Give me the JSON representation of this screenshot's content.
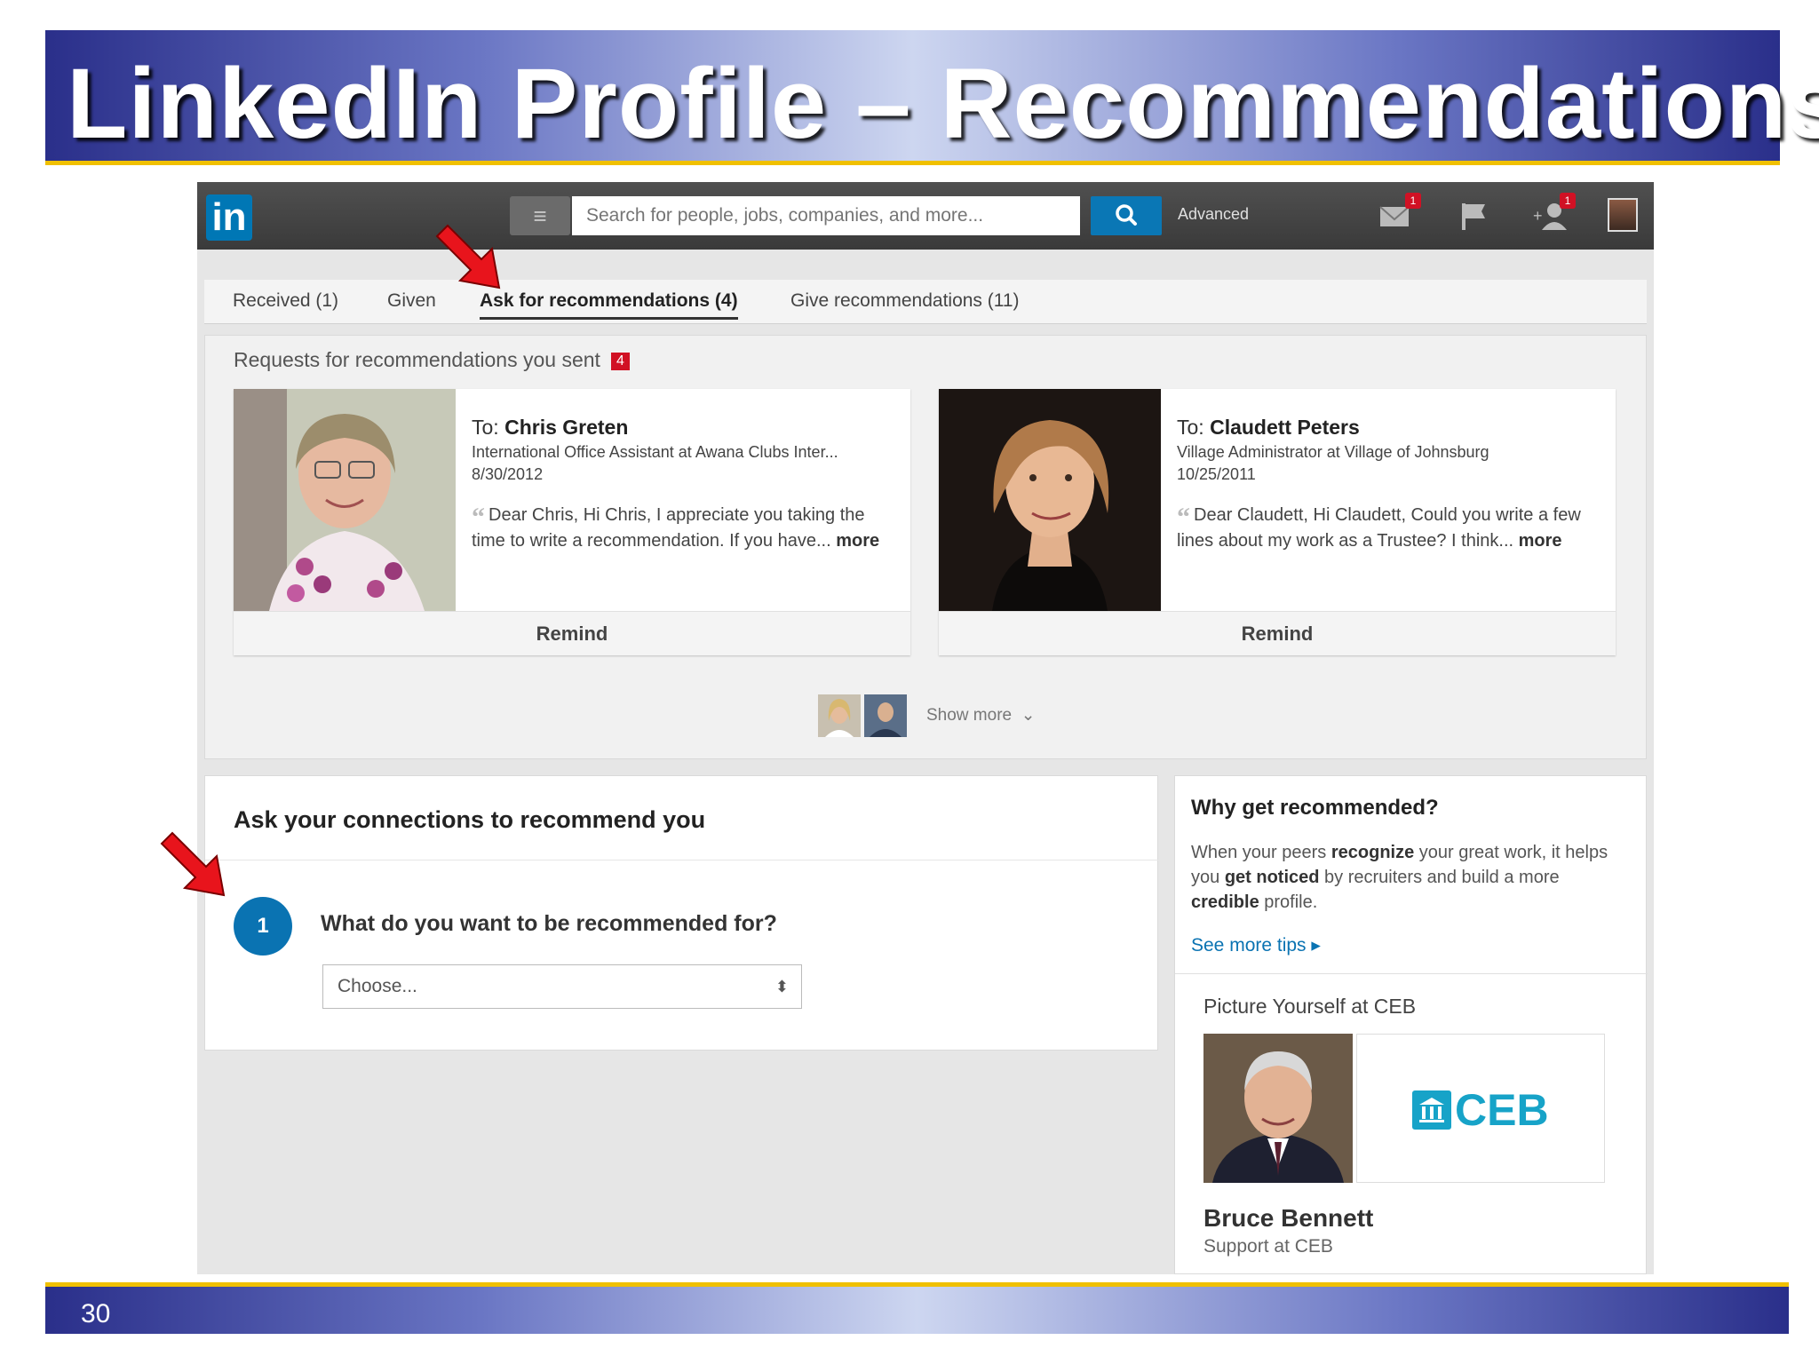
{
  "slide": {
    "title": "LinkedIn Profile – Recommendations",
    "page_number": "30"
  },
  "navbar": {
    "logo": "in",
    "search_placeholder": "Search for people, jobs, companies, and more...",
    "advanced_label": "Advanced",
    "messages_badge": "1",
    "connections_badge": "1"
  },
  "tabs": [
    {
      "label": "Received (1)"
    },
    {
      "label": "Given"
    },
    {
      "label": "Ask for recommendations (4)"
    },
    {
      "label": "Give recommendations (11)"
    }
  ],
  "requests": {
    "title": "Requests for recommendations you sent",
    "count": "4",
    "cards": [
      {
        "to_prefix": "To:",
        "name": "Chris Greten",
        "headline": "International Office Assistant at Awana Clubs Inter...",
        "date": "8/30/2012",
        "message": "Dear Chris, Hi Chris, I appreciate you taking the time to write a recommendation. If you have...",
        "more_label": "more",
        "remind_label": "Remind"
      },
      {
        "to_prefix": "To:",
        "name": "Claudett Peters",
        "headline": "Village Administrator at Village of Johnsburg",
        "date": "10/25/2011",
        "message": "Dear Claudett, Hi Claudett, Could you write a few lines about my work as a Trustee? I think...",
        "more_label": "more",
        "remind_label": "Remind"
      }
    ],
    "show_more_label": "Show more"
  },
  "ask": {
    "title": "Ask your connections to recommend you",
    "step_number": "1",
    "question": "What do you want to be recommended for?",
    "select_value": "Choose..."
  },
  "sidebar": {
    "why_title": "Why get recommended?",
    "why_text_parts": [
      "When your peers ",
      "recognize",
      " your great work, it helps you ",
      "get noticed",
      " by recruiters and build a more ",
      "credible",
      " profile."
    ],
    "tips_link": "See more tips ▸",
    "ad_title": "Picture Yourself at CEB",
    "ad_logo_text": "CEB",
    "ad_name": "Bruce Bennett",
    "ad_role": "Support at CEB"
  },
  "colors": {
    "linkedin_blue": "#0077b5",
    "badge_red": "#d11124",
    "title_gold": "#f0c000",
    "ceb_teal": "#17a3c8"
  }
}
